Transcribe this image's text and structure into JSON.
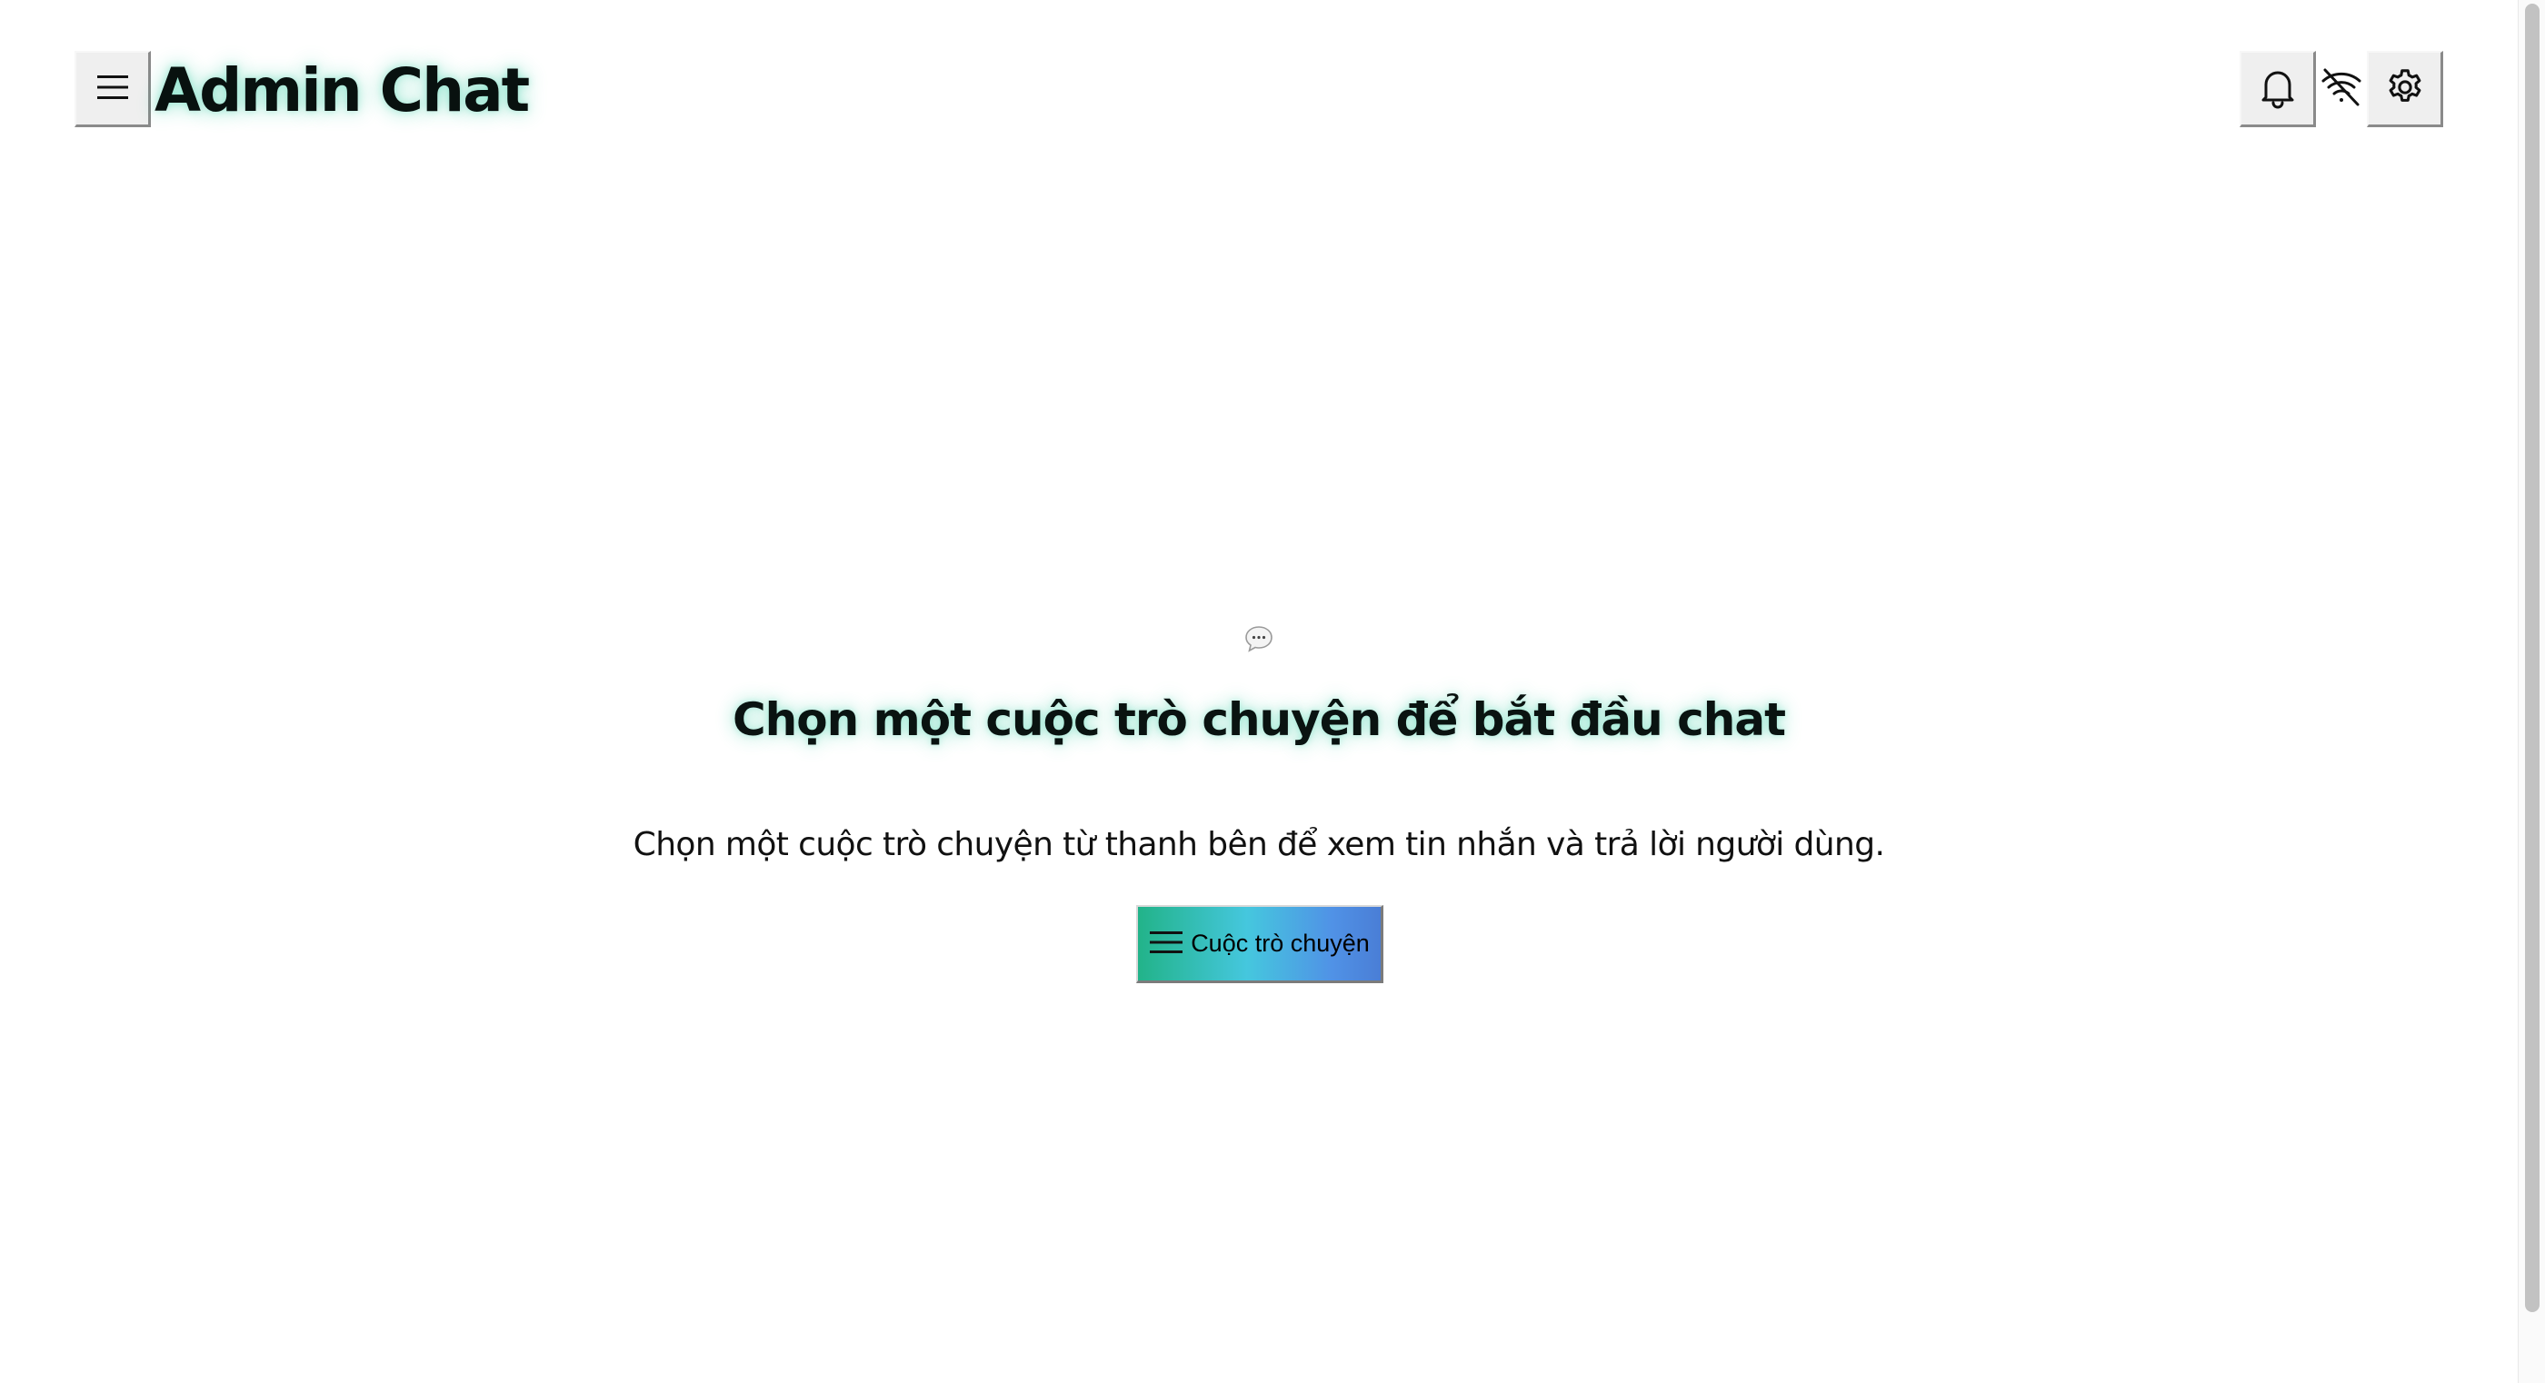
{
  "header": {
    "title": "Admin Chat",
    "menu_icon": "hamburger-menu-icon",
    "notification_icon": "bell-icon",
    "connection_icon": "wifi-off-icon",
    "settings_icon": "gear-icon"
  },
  "empty_state": {
    "icon": "chat-bubble-icon",
    "title": "Chọn một cuộc trò chuyện để bắt đầu chat",
    "description": "Chọn một cuộc trò chuyện từ thanh bên để xem tin nhắn và trả lời người dùng.",
    "button_label": "Cuộc trò chuyện",
    "button_icon": "hamburger-menu-icon"
  },
  "colors": {
    "title_glow": "#14c896",
    "button_gradient_start": "#22b389",
    "button_gradient_mid": "#45c7de",
    "button_gradient_end": "#4a7ed6"
  }
}
